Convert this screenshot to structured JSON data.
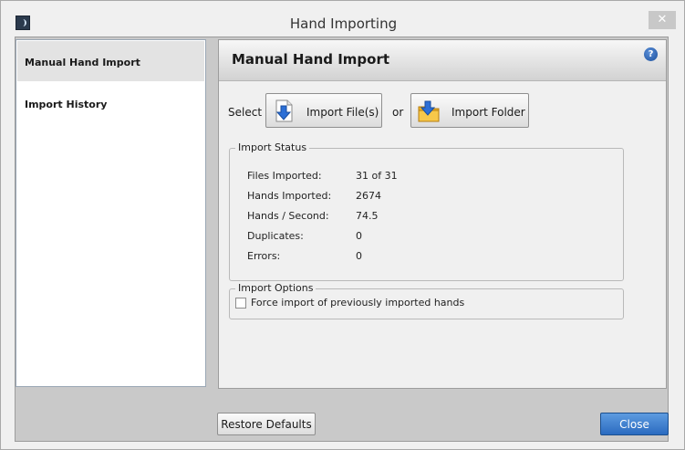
{
  "window": {
    "title": "Hand Importing",
    "close_glyph": "✕"
  },
  "sidebar": {
    "items": [
      {
        "label": "Manual Hand Import",
        "active": true
      },
      {
        "label": "Import History",
        "active": false
      }
    ]
  },
  "content": {
    "heading": "Manual Hand Import",
    "help_glyph": "?",
    "select_label": "Select",
    "or_label": "or",
    "import_files_label": "Import File(s)",
    "import_folder_label": "Import Folder"
  },
  "import_status": {
    "title": "Import Status",
    "rows": [
      {
        "label": "Files Imported:",
        "value": "31 of 31"
      },
      {
        "label": "Hands Imported:",
        "value": "2674"
      },
      {
        "label": "Hands / Second:",
        "value": "74.5"
      },
      {
        "label": "Duplicates:",
        "value": "0"
      },
      {
        "label": "Errors:",
        "value": "0"
      }
    ]
  },
  "import_options": {
    "title": "Import Options",
    "force_label": "Force import of previously imported hands",
    "force_checked": false
  },
  "footer": {
    "restore_label": "Restore Defaults",
    "close_label": "Close"
  },
  "colors": {
    "accent": "#2b6bc0",
    "folder": "#f0b429",
    "arrow": "#2c6fd6"
  },
  "icons": {
    "app": "app-logo-icon",
    "help": "help-icon",
    "import_files": "import-file-icon",
    "import_folder": "import-folder-icon"
  }
}
